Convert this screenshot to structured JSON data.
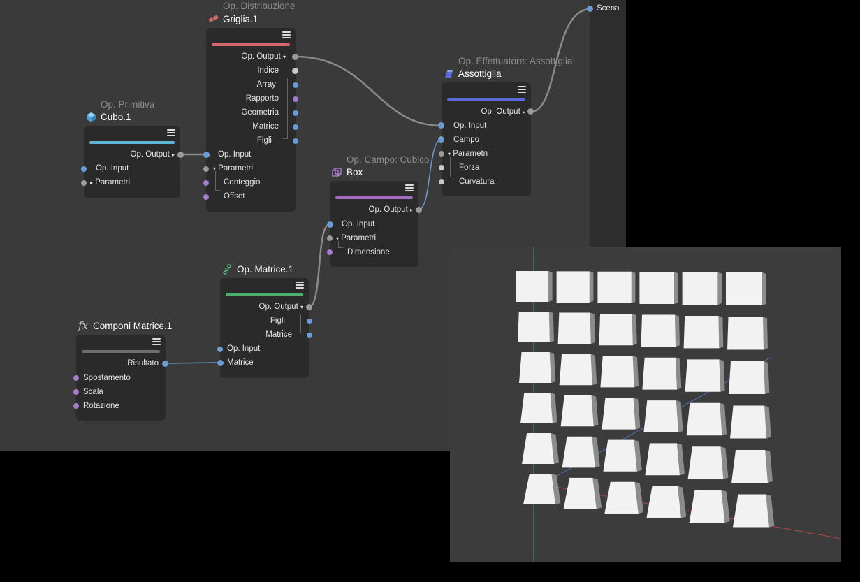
{
  "scene": {
    "label": "Scena"
  },
  "nodes": {
    "griglia": {
      "op": "Op. Distribuzione",
      "title": "Griglia.1",
      "accent": "#d26a6a",
      "rows": [
        "Op. Output",
        "Indice",
        "Array",
        "Rapporto",
        "Geometria",
        "Matrice",
        "Figli",
        "Op. Input",
        "Parametri",
        "Conteggio",
        "Offset"
      ]
    },
    "cubo": {
      "op": "Op. Primitiva",
      "title": "Cubo.1",
      "accent": "#5fb4d8",
      "rows": [
        "Op. Output",
        "Op. Input",
        "Parametri"
      ]
    },
    "box": {
      "op": "Op. Campo: Cubico",
      "title": "Box",
      "accent": "#a36ac0",
      "rows": [
        "Op. Output",
        "Op. Input",
        "Parametri",
        "Dimensione"
      ]
    },
    "assottiglia": {
      "op": "Op. Effettuatore: Assottiglia",
      "title": "Assottiglia",
      "accent": "#5b6ad8",
      "rows": [
        "Op. Output",
        "Op. Input",
        "Campo",
        "Parametri",
        "Forza",
        "Curvatura"
      ]
    },
    "matrice": {
      "title": "Op. Matrice.1",
      "accent": "#4fae6a",
      "rows": [
        "Op. Output",
        "Figli",
        "Matrice",
        "Op. Input",
        "Matrice"
      ]
    },
    "componi": {
      "icon": "fx",
      "title": "Componi Matrice.1",
      "accent": "#6e6e6e",
      "rows": [
        "Risultato",
        "Spostamento",
        "Scala",
        "Rotazione"
      ]
    }
  },
  "colors": {
    "background": "#3a3a3a",
    "node": "#2a2a2a",
    "port_blue": "#6a9dd8",
    "port_purple": "#a57bd0",
    "wire": "#8a8a8a"
  },
  "viewport": {
    "grid_columns": 6,
    "grid_rows": 6,
    "object": "tapered cubes"
  }
}
